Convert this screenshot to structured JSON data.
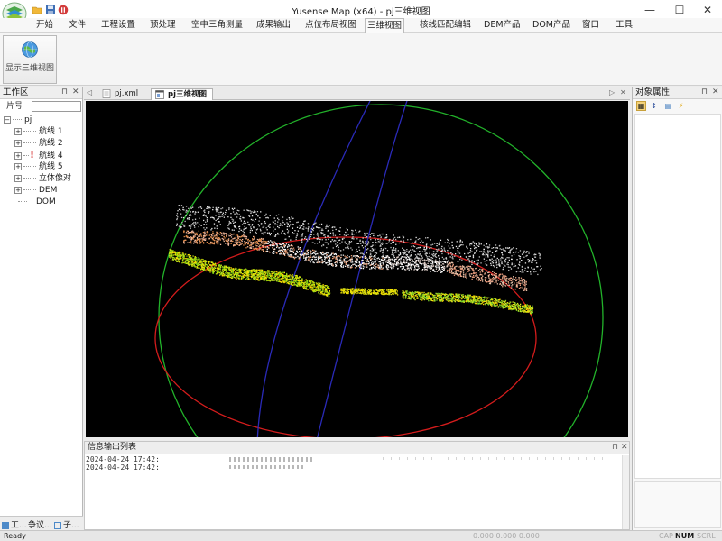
{
  "window": {
    "title": "Yusense Map (x64) - pj三维视图",
    "minimize": "—",
    "maximize": "☐",
    "close": "✕"
  },
  "ribbon": {
    "tabs": [
      "开始",
      "文件",
      "工程设置",
      "预处理",
      "空中三角测量",
      "成果输出",
      "点位布局视图",
      "三维视图",
      "核线匹配编辑",
      "DEM产品",
      "DOM产品",
      "窗口",
      "工具"
    ],
    "active_tab": "三维视图",
    "show3d_label": "显示三维视图"
  },
  "workspace": {
    "title": "工作区",
    "search_label": "片号",
    "search_value": "",
    "tree": {
      "root": "pj",
      "items": [
        "航线 1",
        "航线 2",
        "航线 4",
        "航线 5",
        "立体像对",
        "DEM",
        "DOM"
      ]
    },
    "bottom_tabs": [
      "工...",
      "争议...",
      "子..."
    ]
  },
  "documents": {
    "tabs": [
      "pj.xml",
      "pj三维视图"
    ],
    "active": "pj三维视图"
  },
  "output": {
    "title": "信息输出列表",
    "lines": [
      "2024-04-24  17:42:",
      "2024-04-24  17:42:"
    ]
  },
  "properties": {
    "title": "对象属性"
  },
  "status": {
    "ready": "Ready",
    "coords": "0.000  0.000  0.000",
    "cap": "CAP",
    "num": "NUM",
    "scrl": "SCRL"
  },
  "colors": {
    "sphere_green": "#22b22a",
    "sphere_red": "#d41c1c",
    "sphere_blue": "#2a2ab8"
  }
}
